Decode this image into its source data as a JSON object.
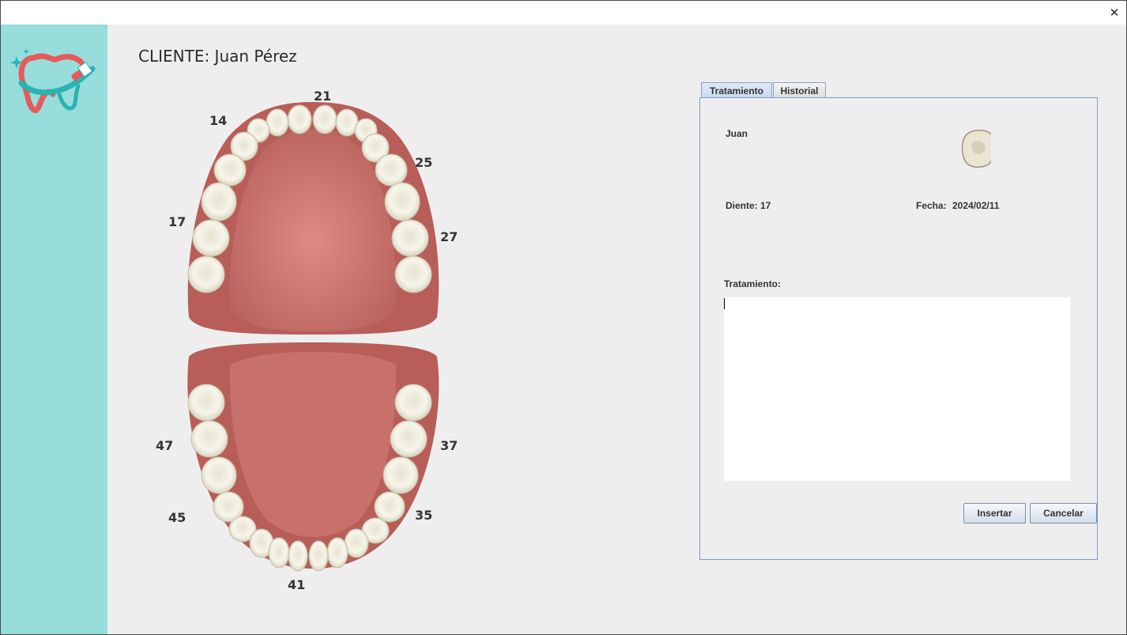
{
  "window": {
    "close_glyph": "✕"
  },
  "client": {
    "label": "CLIENTE: Juan Pérez"
  },
  "tooth_numbers": {
    "upper": [
      "21",
      "14",
      "25",
      "17",
      "27"
    ],
    "lower": [
      "47",
      "37",
      "45",
      "35",
      "41"
    ]
  },
  "tabs": [
    {
      "label": "Tratamiento",
      "active": true
    },
    {
      "label": "Historial",
      "active": false
    }
  ],
  "form": {
    "name": "Juan",
    "tooth_label": "Diente: 17",
    "date_label": "Fecha:",
    "date_value": "2024/02/11",
    "treatment_label": "Tratamiento:",
    "treatment_value": ""
  },
  "buttons": {
    "insert": "Insertar",
    "cancel": "Cancelar"
  },
  "colors": {
    "sidebar": "#96dddb",
    "gum": "#c46f6a",
    "palate": "#d88782",
    "tooth": "#f3f1e4",
    "tab_border": "#7a9cc6"
  }
}
